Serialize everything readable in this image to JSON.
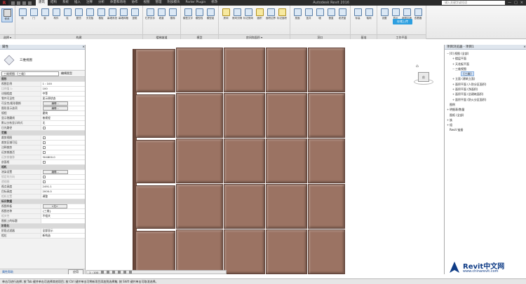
{
  "titlebar": {
    "app_letter": "R",
    "tabs": [
      "建筑",
      "结构",
      "系统",
      "插入",
      "注释",
      "分析",
      "体量和场地",
      "协作",
      "视图",
      "管理",
      "附加模块",
      "Parter Plugin",
      "修改"
    ],
    "active_tab_index": 0,
    "title": "Autodesk Revit 2016",
    "search_placeholder": "键入关键字或短语",
    "controls": [
      "—",
      "□",
      "×"
    ]
  },
  "ribbon": {
    "groups": [
      {
        "label": "选择 ▾",
        "tools": [
          {
            "label": "修改",
            "style": "g"
          }
        ]
      },
      {
        "label": "构建",
        "tools": [
          {
            "label": "墙"
          },
          {
            "label": "门"
          },
          {
            "label": "窗"
          },
          {
            "label": "构件"
          },
          {
            "label": "柱"
          },
          {
            "label": "屋顶"
          },
          {
            "label": "天花板"
          },
          {
            "label": "楼板"
          },
          {
            "label": "幕墙系统"
          },
          {
            "label": "幕墙网格"
          },
          {
            "label": "竖梃"
          }
        ]
      },
      {
        "label": "楼梯坡道",
        "tools": [
          {
            "label": "栏杆扶手"
          },
          {
            "label": "坡道"
          },
          {
            "label": "楼梯"
          }
        ]
      },
      {
        "label": "模型",
        "tools": [
          {
            "label": "模型文字"
          },
          {
            "label": "模型线"
          },
          {
            "label": "模型组"
          }
        ]
      },
      {
        "label": "房间和面积 ▾",
        "tools": [
          {
            "label": "房间",
            "style": "y"
          },
          {
            "label": "房间分隔"
          },
          {
            "label": "标记房间"
          },
          {
            "label": "面积",
            "style": "y"
          },
          {
            "label": "面积边界"
          },
          {
            "label": "标记面积",
            "style": "y"
          }
        ]
      },
      {
        "label": "洞口",
        "tools": [
          {
            "label": "按面"
          },
          {
            "label": "竖井"
          },
          {
            "label": "墙"
          },
          {
            "label": "垂直"
          },
          {
            "label": "老虎窗"
          }
        ]
      },
      {
        "label": "基准",
        "tools": [
          {
            "label": "标高"
          },
          {
            "label": "轴网"
          }
        ]
      },
      {
        "label": "工作平面",
        "tools": [
          {
            "label": "设置"
          },
          {
            "label": "显示"
          },
          {
            "label": "参照平面"
          },
          {
            "label": "查看器"
          }
        ]
      }
    ],
    "cloud_button": "存储上传"
  },
  "properties": {
    "title": "属性",
    "close": "×",
    "type_name": "三维视图",
    "filter_value": "三维视图: {三维}",
    "edit_type": "编辑类型",
    "rows": [
      {
        "k": "图形",
        "hdr": true
      },
      {
        "k": "视图比例",
        "v": "1 : 100"
      },
      {
        "k": "比例值 1:",
        "v": "100",
        "dim": true
      },
      {
        "k": "详细程度",
        "v": "中等"
      },
      {
        "k": "零件可见性",
        "v": "显示原状态"
      },
      {
        "k": "可见性/图形替换",
        "btn": "编辑..."
      },
      {
        "k": "图形显示选项",
        "btn": "编辑..."
      },
      {
        "k": "规程",
        "v": "建筑"
      },
      {
        "k": "显示隐藏线",
        "v": "按规程"
      },
      {
        "k": "默认分析显示样式",
        "v": "无"
      },
      {
        "k": "日光路径",
        "chk": true
      },
      {
        "k": "范围",
        "hdr": true
      },
      {
        "k": "裁剪视图",
        "chk": true
      },
      {
        "k": "裁剪区域可见",
        "chk": true
      },
      {
        "k": "注释裁剪",
        "chk": true
      },
      {
        "k": "远剪裁激活",
        "chk": true
      },
      {
        "k": "远剪裁偏移",
        "v": "304800.0",
        "dim": true
      },
      {
        "k": "剖面框",
        "chk": true
      },
      {
        "k": "相机",
        "hdr": true
      },
      {
        "k": "渲染设置",
        "btn": "编辑..."
      },
      {
        "k": "锁定的方向",
        "chk": true,
        "dim": true
      },
      {
        "k": "透视图",
        "chk": true,
        "dim": true
      },
      {
        "k": "视点高度",
        "v": "2491.1"
      },
      {
        "k": "目标高度",
        "v": "2000.0"
      },
      {
        "k": "相机位置",
        "v": "调整",
        "dim": true
      },
      {
        "k": "标识数据",
        "hdr": true
      },
      {
        "k": "视图样板",
        "btn": "<无>"
      },
      {
        "k": "视图名称",
        "v": "{三维}"
      },
      {
        "k": "相关性",
        "v": "不相关",
        "dim": true
      },
      {
        "k": "图纸上的标题",
        "v": ""
      },
      {
        "k": "阶段化",
        "hdr": true
      },
      {
        "k": "阶段过滤器",
        "v": "全部显示"
      },
      {
        "k": "相位",
        "v": "新构造"
      }
    ],
    "help_link": "属性帮助",
    "apply": "应用"
  },
  "viewport": {
    "viewcube_label": "前",
    "wall": {
      "columns": 5,
      "rows": 5,
      "tile_color": "#9b7363",
      "joint_color": "#5e4036"
    }
  },
  "viewbar": {
    "scale": "1 : 100"
  },
  "browser": {
    "title": "项目浏览器 - 项目1",
    "close": "×",
    "items": [
      {
        "label": "[0] 视图 (全部)",
        "depth": 0,
        "tog": "−"
      },
      {
        "label": "楼层平面",
        "depth": 1,
        "tog": "+"
      },
      {
        "label": "天花板平面",
        "depth": 1,
        "tog": "+"
      },
      {
        "label": "三维视图",
        "depth": 1,
        "tog": "−"
      },
      {
        "label": "{三维}",
        "depth": 2,
        "tog": "",
        "selected": true
      },
      {
        "label": "立面 (建筑立面)",
        "depth": 1,
        "tog": "+"
      },
      {
        "label": "面积平面 (人防分区面积)",
        "depth": 1,
        "tog": "+"
      },
      {
        "label": "面积平面 (净面积)",
        "depth": 1,
        "tog": "+"
      },
      {
        "label": "面积平面 (总建筑面积)",
        "depth": 1,
        "tog": "+"
      },
      {
        "label": "面积平面 (防火分区面积)",
        "depth": 1,
        "tog": "+"
      },
      {
        "label": "图例",
        "depth": 0,
        "tog": ""
      },
      {
        "label": "明细表/数量",
        "depth": 0,
        "tog": "+"
      },
      {
        "label": "图纸 (全部)",
        "depth": 0,
        "tog": ""
      },
      {
        "label": "族",
        "depth": 0,
        "tog": "+"
      },
      {
        "label": "组",
        "depth": 0,
        "tog": "+"
      },
      {
        "label": "Revit 链接",
        "depth": 0,
        "tog": ""
      }
    ]
  },
  "statusbar": {
    "text": "单击可进行选择; 按 Tab 键并单击可选择其他项目; 按 Ctrl 键并单击可将新项目添加到选择集; 按 Shift 键并单击可取消选择。"
  },
  "watermark": {
    "brand": "Revit中文网",
    "url": "www.chinarevit.com",
    "color": "#0f3c86"
  }
}
